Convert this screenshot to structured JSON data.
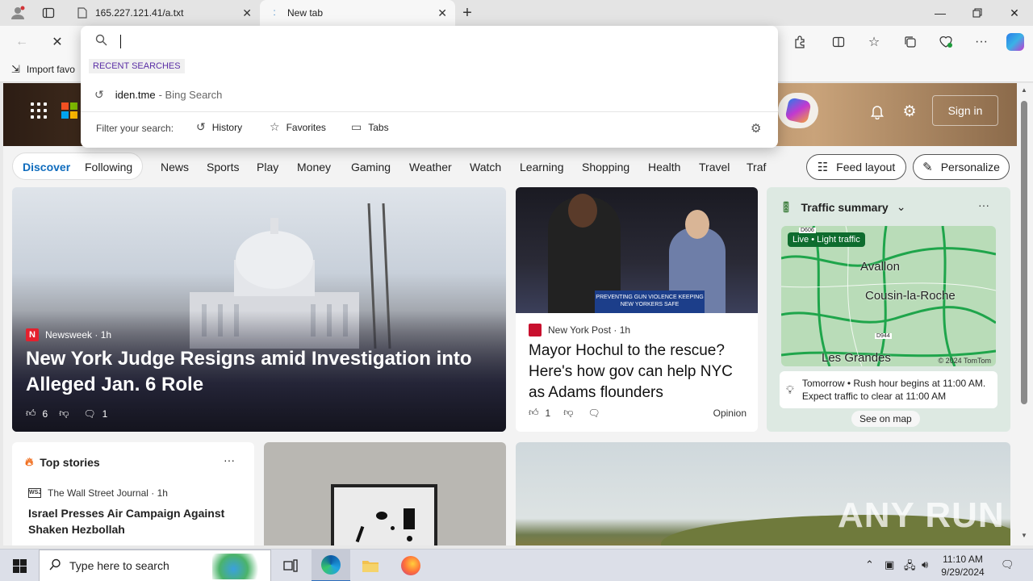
{
  "titlebar": {
    "tabs": [
      {
        "label": "165.227.121.41/a.txt"
      },
      {
        "label": "New tab"
      }
    ]
  },
  "favorites": {
    "import_label": "Import favo"
  },
  "address_dropdown": {
    "input_value": "",
    "section_title": "RECENT SEARCHES",
    "recent": [
      {
        "query": "iden.tme",
        "suffix": "- Bing Search"
      }
    ],
    "filter_label": "Filter your search:",
    "filters": [
      "History",
      "Favorites",
      "Tabs"
    ]
  },
  "hero_bar": {
    "signin_label": "Sign in"
  },
  "nav": {
    "pill": [
      "Discover",
      "Following"
    ],
    "items": [
      "News",
      "Sports",
      "Play",
      "Money",
      "Gaming",
      "Weather",
      "Watch",
      "Learning",
      "Shopping",
      "Health",
      "Travel",
      "Traf"
    ],
    "feed_layout": "Feed layout",
    "personalize": "Personalize"
  },
  "hero_card": {
    "source": "Newsweek",
    "age": "· 1h",
    "headline": "New York Judge Resigns amid Investigation into Alleged Jan. 6 Role",
    "likes": "6",
    "comments": "1"
  },
  "nypost_card": {
    "banner": "PREVENTING GUN VIOLENCE KEEPING NEW YORKERS SAFE",
    "source": "New York Post",
    "age": "· 1h",
    "headline": "Mayor Hochul to the rescue? Here's how gov can help NYC as Adams flounders",
    "likes": "1",
    "tag": "Opinion"
  },
  "traffic_card": {
    "title": "Traffic summary",
    "live_badge": "Live • Light traffic",
    "places": [
      "Avallon",
      "Cousin-la-Roche",
      "Les Grandes"
    ],
    "roads": [
      "D606",
      "D944"
    ],
    "copyright": "© 2024 TomTom",
    "alert": "Tomorrow • Rush hour begins at 11:00 AM. Expect traffic to clear at 11:00 AM",
    "see_map": "See on map"
  },
  "top_stories": {
    "title": "Top stories",
    "source": "The Wall Street Journal",
    "source_logo": "WSJ",
    "age": "· 1h",
    "headline": "Israel Presses Air Campaign Against Shaken Hezbollah"
  },
  "watermark": "ANY RUN",
  "taskbar": {
    "search_placeholder": "Type here to search",
    "time": "11:10 AM",
    "date": "9/29/2024"
  },
  "colors": {
    "accent": "#0f6cbd",
    "recent_section": "#5a2ea5",
    "traffic_live": "#0e6c2e"
  }
}
